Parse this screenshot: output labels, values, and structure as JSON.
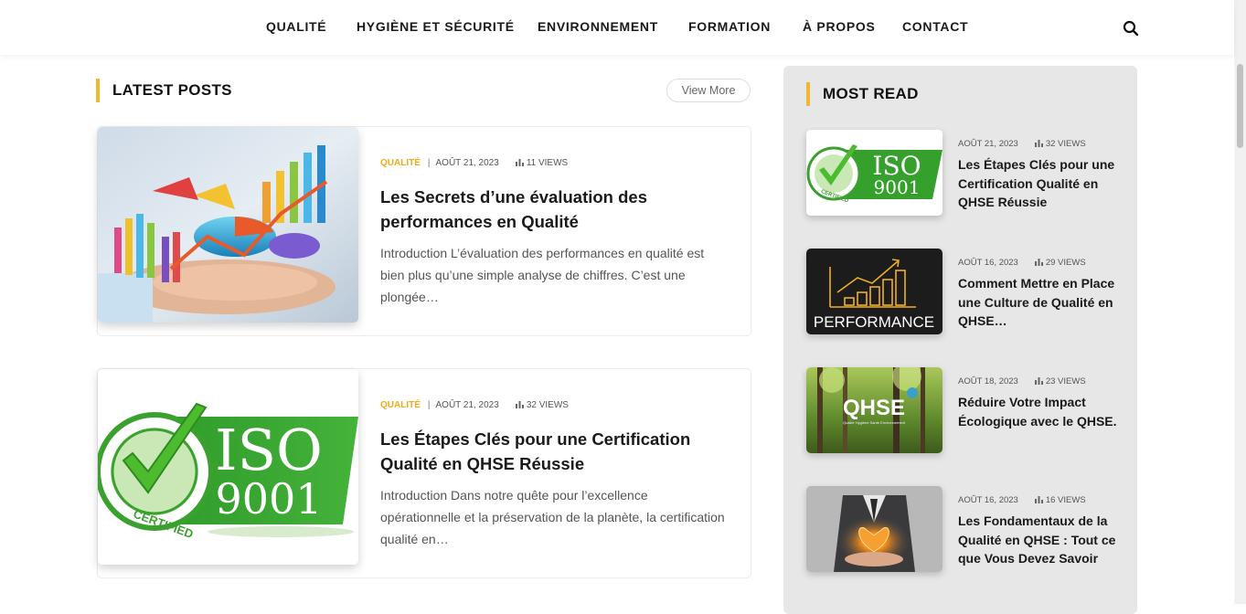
{
  "nav": {
    "items": [
      {
        "label": "QUALITÉ"
      },
      {
        "label": "HYGIÈNE ET SÉCURITÉ"
      },
      {
        "label": "ENVIRONNEMENT"
      },
      {
        "label": "FORMATION"
      },
      {
        "label": "À PROPOS"
      },
      {
        "label": "CONTACT"
      }
    ],
    "search_icon": "search-icon"
  },
  "latest": {
    "title": "LATEST POSTS",
    "view_more": "View More",
    "posts": [
      {
        "category": "QUALITÉ",
        "date": "AOÛT 21, 2023",
        "views": "11 VIEWS",
        "title": "Les Secrets d’une évaluation des performances en Qualité",
        "excerpt": "Introduction L’évaluation des performances en qualité est bien plus qu’une simple analyse de chiffres. C’est une plongée…"
      },
      {
        "category": "QUALITÉ",
        "date": "AOÛT 21, 2023",
        "views": "32 VIEWS",
        "title": "Les Étapes Clés pour une Certification Qualité en QHSE Réussie",
        "excerpt": "Introduction Dans notre quête pour l’excellence opérationnelle et la préservation de la planète, la certification qualité en…"
      }
    ]
  },
  "most_read": {
    "title": "MOST READ",
    "posts": [
      {
        "date": "AOÛT 21, 2023",
        "views": "32 VIEWS",
        "title": "Les Étapes Clés pour une Certification Qualité en QHSE Réussie"
      },
      {
        "date": "AOÛT 16, 2023",
        "views": "29 VIEWS",
        "title": "Comment Mettre en Place une Culture de Qualité en QHSE…"
      },
      {
        "date": "AOÛT 18, 2023",
        "views": "23 VIEWS",
        "title": "Réduire Votre Impact Écologique avec le QHSE."
      },
      {
        "date": "AOÛT 16, 2023",
        "views": "16 VIEWS",
        "title": "Les Fondamentaux de la Qualité en QHSE : Tout ce que Vous Devez Savoir"
      }
    ]
  },
  "images": {
    "iso_line1": "ISO",
    "iso_line2": "9001",
    "iso_badge": "CERTIFIED",
    "performance_label": "PERFORMANCE",
    "qhse_label": "QHSE",
    "qhse_sub": "Qualité Hygiène Santé Environnement"
  },
  "colors": {
    "accent": "#f2b632",
    "category": "#f0a919",
    "sidebar_bg": "#e7e7e7",
    "iso_green": "#3aa12f"
  }
}
